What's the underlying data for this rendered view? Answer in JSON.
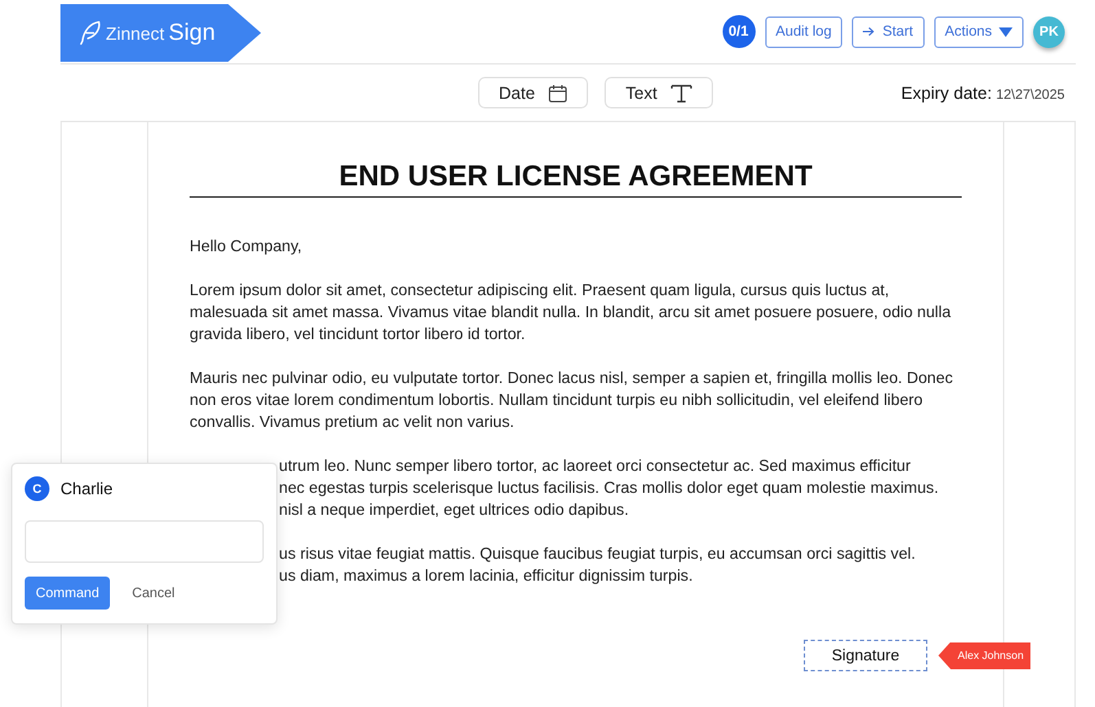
{
  "header": {
    "logo": {
      "light": "Zinnect",
      "bold": "Sign"
    },
    "counter": "0/1",
    "buttons": [
      {
        "label": "Audit log",
        "kind": "plain"
      },
      {
        "label": "Start",
        "kind": "lead-arrow"
      },
      {
        "label": "Actions",
        "kind": "dropdown"
      }
    ],
    "avatar": "PK"
  },
  "toolbar": {
    "fields": [
      {
        "label": "Date",
        "kind": "date"
      },
      {
        "label": "Text",
        "kind": "text"
      }
    ],
    "expiry_label": "Expiry date:",
    "expiry_value": "12\\27\\2025"
  },
  "document": {
    "title": "END USER LICENSE AGREEMENT",
    "paragraphs": [
      "Hello Company,",
      "Lorem ipsum dolor sit amet, consectetur adipiscing elit. Praesent quam ligula, cursus quis luctus at, malesuada sit amet massa. Vivamus vitae blandit nulla. In blandit, arcu sit amet posuere posuere, odio nulla gravida libero, vel tincidunt tortor libero id tortor.",
      "Mauris nec pulvinar odio, eu vulputate tortor. Donec lacus nisl, semper a sapien et, fringilla mollis leo. Donec non eros vitae lorem condimentum lobortis. Nullam tincidunt turpis eu nibh sollicitudin, vel eleifend libero convallis. Vivamus pretium ac velit non varius."
    ],
    "partial_paragraphs": [
      [
        "utrum leo. Nunc semper libero tortor, ac laoreet orci consectetur ac. Sed maximus efficitur",
        "nec egestas turpis scelerisque luctus facilisis. Cras mollis dolor eget quam molestie maximus.",
        "nisl a neque imperdiet, eget ultrices odio dapibus."
      ],
      [
        "us risus vitae feugiat mattis. Quisque faucibus feugiat turpis, eu accumsan orci sagittis vel.",
        "us diam, maximus a lorem lacinia, efficitur dignissim turpis."
      ]
    ],
    "signature": {
      "label": "Signature",
      "assignee": "Alex Johnson",
      "color": "#f44336"
    }
  },
  "comment_popup": {
    "avatar": "C",
    "name": "Charlie",
    "buttons": [
      {
        "label": "Command",
        "kind": "primary"
      },
      {
        "label": "Cancel",
        "kind": "text"
      }
    ]
  }
}
